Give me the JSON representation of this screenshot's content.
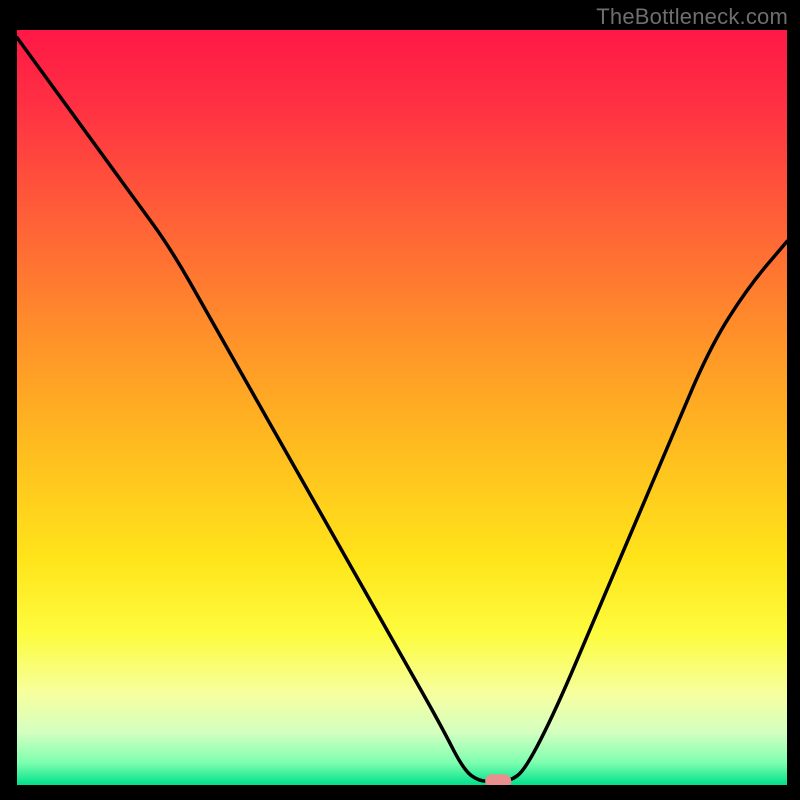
{
  "watermark": "TheBottleneck.com",
  "chart_data": {
    "type": "line",
    "title": "",
    "xlabel": "",
    "ylabel": "",
    "xlim": [
      0,
      100
    ],
    "ylim": [
      0,
      100
    ],
    "grid": false,
    "legend": false,
    "series": [
      {
        "name": "bottleneck-curve",
        "x": [
          0,
          5,
          10,
          15,
          20,
          25,
          30,
          35,
          40,
          45,
          50,
          55,
          58,
          60,
          62,
          64,
          66,
          70,
          75,
          80,
          85,
          90,
          95,
          100
        ],
        "values": [
          99,
          92,
          85,
          78,
          71,
          62,
          53,
          44,
          35,
          26,
          17,
          8,
          2,
          0.5,
          0.5,
          0.5,
          2,
          10,
          22,
          34,
          46,
          58,
          66,
          72
        ]
      }
    ],
    "marker": {
      "x": 62.5,
      "y": 0.5,
      "color": "#ea8f8f"
    },
    "gradient_stops": [
      {
        "offset": 0.0,
        "color": "#ff1846"
      },
      {
        "offset": 0.1,
        "color": "#ff3043"
      },
      {
        "offset": 0.25,
        "color": "#ff6037"
      },
      {
        "offset": 0.4,
        "color": "#ff8f2a"
      },
      {
        "offset": 0.55,
        "color": "#ffbb1f"
      },
      {
        "offset": 0.7,
        "color": "#ffe41a"
      },
      {
        "offset": 0.8,
        "color": "#fdfc3e"
      },
      {
        "offset": 0.88,
        "color": "#f6ffa0"
      },
      {
        "offset": 0.93,
        "color": "#d4ffc0"
      },
      {
        "offset": 0.97,
        "color": "#7fffb0"
      },
      {
        "offset": 1.0,
        "color": "#00e08a"
      }
    ]
  }
}
